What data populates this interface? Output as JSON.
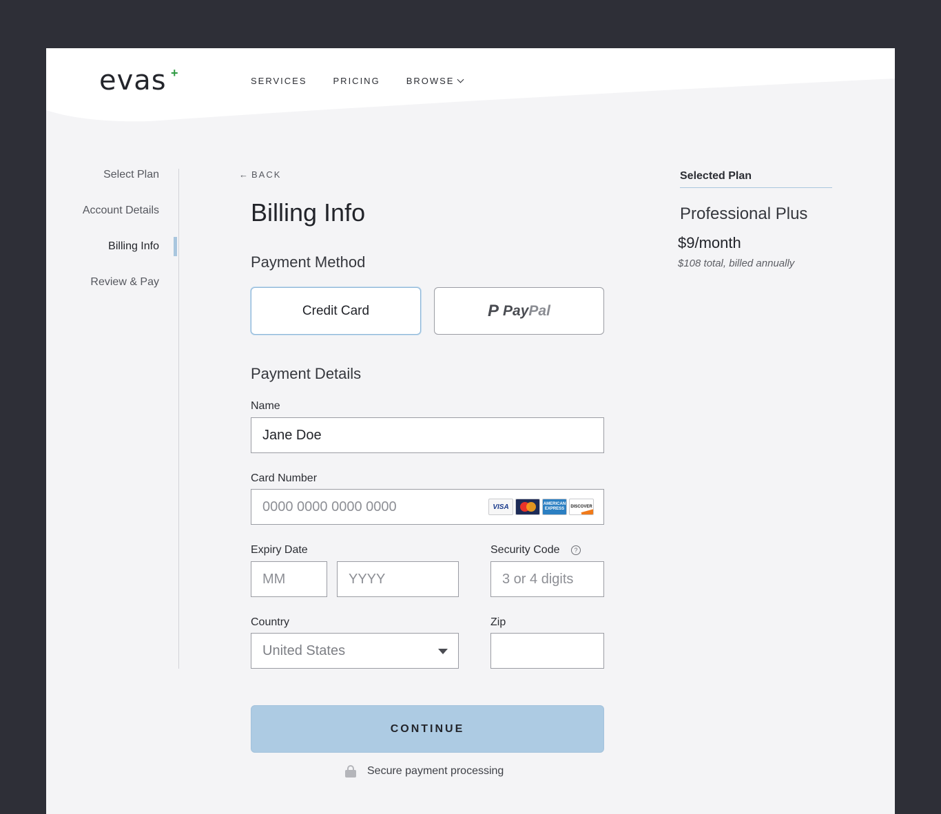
{
  "brand": {
    "logo_text": "evas",
    "logo_mark": "+"
  },
  "nav": {
    "items": [
      "SERVICES",
      "PRICING",
      "BROWSE"
    ]
  },
  "steps": [
    "Select Plan",
    "Account Details",
    "Billing Info",
    "Review & Pay"
  ],
  "active_step": "Billing Info",
  "back_label": "BACK",
  "page_title": "Billing Info",
  "payment_method": {
    "title": "Payment Method",
    "options": {
      "credit": "Credit Card",
      "paypal_a": "Pay",
      "paypal_b": "Pal",
      "paypal_icon": "P"
    },
    "selected": "Credit Card"
  },
  "payment_details": {
    "title": "Payment Details",
    "name": {
      "label": "Name",
      "value": "Jane Doe"
    },
    "card_number": {
      "label": "Card Number",
      "placeholder": "0000 0000 0000 0000",
      "cards": [
        "VISA",
        "MasterCard",
        "AMERICAN EXPRESS",
        "DISCOVER"
      ]
    },
    "expiry": {
      "label": "Expiry Date",
      "mm_placeholder": "MM",
      "yyyy_placeholder": "YYYY"
    },
    "security": {
      "label": "Security Code",
      "placeholder": "3 or 4 digits",
      "help": "?"
    },
    "country": {
      "label": "Country",
      "value": "United States"
    },
    "zip": {
      "label": "Zip",
      "value": ""
    }
  },
  "continue_label": "CONTINUE",
  "secure_text": "Secure payment processing",
  "plan": {
    "heading": "Selected Plan",
    "name": "Professional Plus",
    "price": "$9/month",
    "total": "$108 total, billed annually"
  },
  "colors": {
    "accent": "#adcbe3",
    "brand_plus": "#2e9a42",
    "background": "#2e2f37"
  }
}
